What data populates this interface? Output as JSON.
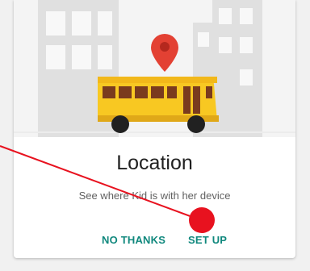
{
  "card": {
    "title": "Location",
    "subtitle": "See where Kid is with her device"
  },
  "actions": {
    "no_thanks_label": "NO THANKS",
    "setup_label": "SET UP"
  },
  "colors": {
    "accent": "#10887d",
    "bus_yellow": "#f8c822",
    "pin_red": "#e34133",
    "tap_indicator": "#e8121f"
  },
  "icons": [
    "location-pin-icon",
    "school-bus-icon"
  ]
}
